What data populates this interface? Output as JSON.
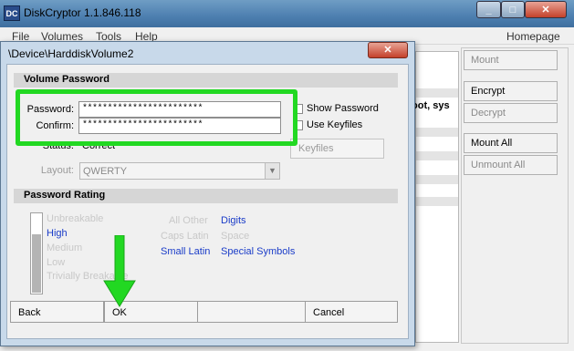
{
  "main_window": {
    "title": "DiskCryptor 1.1.846.118",
    "icon_text": "DC",
    "menu": [
      "File",
      "Volumes",
      "Tools",
      "Help"
    ],
    "homepage_link": "Homepage",
    "list_fragment": "oot, sys",
    "side_buttons": [
      {
        "label": "Mount",
        "enabled": false
      },
      {
        "label": "Encrypt",
        "enabled": true
      },
      {
        "label": "Decrypt",
        "enabled": false
      },
      {
        "label": "Mount All",
        "enabled": true
      },
      {
        "label": "Unmount All",
        "enabled": false
      }
    ]
  },
  "dialog": {
    "title": "\\Device\\HarddiskVolume2",
    "volume_password_header": "Volume Password",
    "password_label": "Password:",
    "password_value": "************************",
    "confirm_label": "Confirm:",
    "confirm_value": "************************",
    "show_password_label": "Show Password",
    "use_keyfiles_label": "Use Keyfiles",
    "status_label": "Status:",
    "status_value": "Correct",
    "keyfiles_button": "Keyfiles",
    "layout_label": "Layout:",
    "layout_value": "QWERTY",
    "rating_header": "Password Rating",
    "rating_levels": [
      "Unbreakable",
      "High",
      "Medium",
      "Low",
      "Trivially Breakable"
    ],
    "active_rating": "High",
    "rating_fill_fraction": 0.72,
    "char_classes": [
      {
        "label": "All Other",
        "on": false
      },
      {
        "label": "Digits",
        "on": true
      },
      {
        "label": "Caps Latin",
        "on": false
      },
      {
        "label": "Space",
        "on": false
      },
      {
        "label": "Small Latin",
        "on": true
      },
      {
        "label": "Special Symbols",
        "on": true
      }
    ],
    "buttons": {
      "back": "Back",
      "ok": "OK",
      "cancel": "Cancel"
    }
  },
  "colors": {
    "annotation": "#22d822",
    "active_text": "#1a3cc8"
  }
}
